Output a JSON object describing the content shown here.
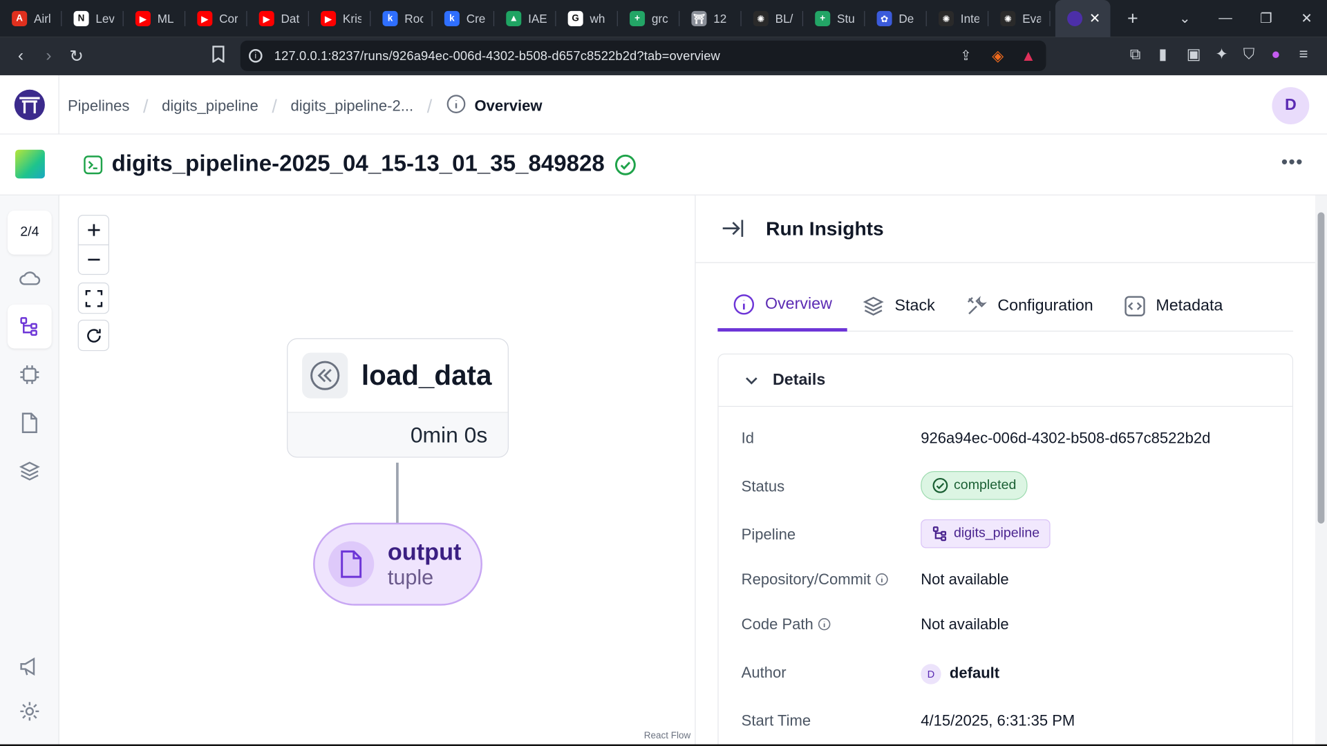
{
  "browser": {
    "tabs": [
      {
        "label": "Airl",
        "color": "#e0301e",
        "glyph": "A"
      },
      {
        "label": "Lev",
        "color": "#ffffff",
        "glyph": "N"
      },
      {
        "label": "ML",
        "color": "#ff0000",
        "glyph": "▶"
      },
      {
        "label": "Cor",
        "color": "#ff0000",
        "glyph": "▶"
      },
      {
        "label": "Dat",
        "color": "#ff0000",
        "glyph": "▶"
      },
      {
        "label": "Kris",
        "color": "#ff0000",
        "glyph": "▶"
      },
      {
        "label": "Roc",
        "color": "#2f6fff",
        "glyph": "k"
      },
      {
        "label": "Cre",
        "color": "#2f6fff",
        "glyph": "k"
      },
      {
        "label": "IAE",
        "color": "#1fa463",
        "glyph": "▲"
      },
      {
        "label": "wh",
        "color": "#ffffff",
        "glyph": "G"
      },
      {
        "label": "grc",
        "color": "#23a566",
        "glyph": "+"
      },
      {
        "label": "12",
        "color": "#8a8f98",
        "glyph": "⛩"
      },
      {
        "label": "BL/",
        "color": "#2a2a2a",
        "glyph": "✺"
      },
      {
        "label": "Stu",
        "color": "#23a566",
        "glyph": "+"
      },
      {
        "label": "De",
        "color": "#3b5bdb",
        "glyph": "✿"
      },
      {
        "label": "Inte",
        "color": "#2a2a2a",
        "glyph": "✺"
      },
      {
        "label": "Eva",
        "color": "#2a2a2a",
        "glyph": "✺"
      }
    ],
    "url": "127.0.0.1:8237/runs/926a94ec-006d-4302-b508-d657c8522b2d?tab=overview"
  },
  "breadcrumbs": {
    "item1": "Pipelines",
    "item2": "digits_pipeline",
    "item3": "digits_pipeline-2...",
    "current": "Overview"
  },
  "user": {
    "initial": "D"
  },
  "run": {
    "title": "digits_pipeline-2025_04_15-13_01_35_849828"
  },
  "sidebar": {
    "counter": "2/4"
  },
  "dag": {
    "step_name": "load_data",
    "step_duration": "0min 0s",
    "artifact_name": "output",
    "artifact_type": "tuple",
    "attribution": "React Flow"
  },
  "panel": {
    "title": "Run Insights",
    "tabs": [
      "Overview",
      "Stack",
      "Configuration",
      "Metadata"
    ],
    "section_title": "Details",
    "details": {
      "id_label": "Id",
      "id_value": "926a94ec-006d-4302-b508-d657c8522b2d",
      "status_label": "Status",
      "status_value": "completed",
      "pipeline_label": "Pipeline",
      "pipeline_value": "digits_pipeline",
      "repo_label": "Repository/Commit",
      "repo_value": "Not available",
      "codepath_label": "Code Path",
      "codepath_value": "Not available",
      "author_label": "Author",
      "author_initial": "D",
      "author_value": "default",
      "start_label": "Start Time",
      "start_value": "4/15/2025, 6:31:35 PM"
    }
  },
  "colors": {
    "accent": "#6d35d7",
    "success": "#1fa34a"
  }
}
